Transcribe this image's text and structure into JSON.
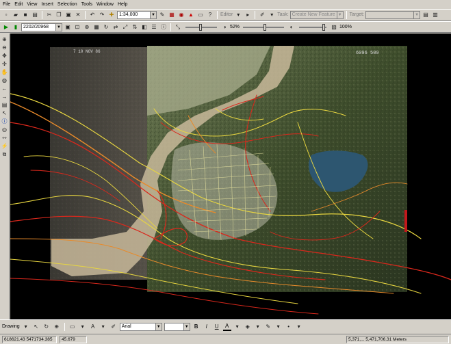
{
  "menu": {
    "items": [
      "File",
      "Edit",
      "View",
      "Insert",
      "Selection",
      "Tools",
      "Window",
      "Help"
    ]
  },
  "toolbar_standard": {
    "scale_value": "1:34,000",
    "layer_target_label": "Task:",
    "layer_target_value": "Create New Feature",
    "target_label": "Target:",
    "editor_label": "Editor"
  },
  "toolbar_georef": {
    "layer_value": "2202/20968",
    "contrast_value": "52%",
    "transparency_value": "100%"
  },
  "map": {
    "frame_label_tl": "7 10 NOV 86",
    "frame_label_tr": "6096 509"
  },
  "drawing_toolbar": {
    "drawing_label": "Drawing",
    "font_value": "Arial",
    "bold": "B",
    "italic": "I",
    "underline": "U"
  },
  "status": {
    "coords_left": "618621.43  5471734.385",
    "extra": "45.679",
    "coords_right": "5,371,...  5,471,706.31  Meters"
  },
  "colors": {
    "chrome": "#d4d0c8",
    "map_background": "#000000",
    "vector_red": "#d9281c",
    "vector_yellow": "#e8d640",
    "vector_orange": "#e88a2a"
  }
}
